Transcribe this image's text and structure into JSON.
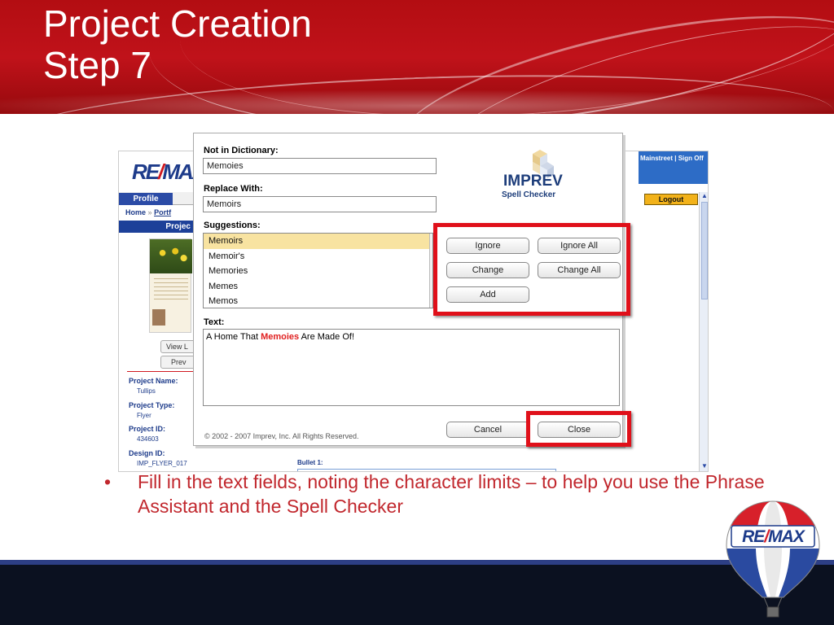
{
  "slide": {
    "title_line1": "Project Creation",
    "title_line2": "Step 7",
    "bullet": "Fill in the text fields, noting the character limits – to help you use the Phrase Assistant and the Spell Checker",
    "bullet_marker": "•"
  },
  "webpage": {
    "logo_text_left": "RE",
    "logo_text_slash": "/",
    "logo_text_right": "MAX",
    "profile_tab": "Profile",
    "nav_home": "Home",
    "nav_sep": "»",
    "nav_portfolio": "Portf",
    "project_bar": "Projec",
    "view_button": "View L",
    "preview_button": "Prev",
    "project_name_label": "Project Name:",
    "project_name_value": "Tullips",
    "project_type_label": "Project Type:",
    "project_type_value": "Flyer",
    "project_id_label": "Project ID:",
    "project_id_value": "434603",
    "design_id_label": "Design ID:",
    "design_id_value": "IMP_FLYER_017",
    "top_right_links": "Mainstreet | Sign Off",
    "logout_button": "Logout",
    "bullet_field_label": "Bullet 1:"
  },
  "spell_checker": {
    "not_in_dictionary_label": "Not in Dictionary:",
    "not_in_dictionary_value": "Memoies",
    "replace_with_label": "Replace With:",
    "replace_with_value": "Memoirs",
    "suggestions_label": "Suggestions:",
    "suggestions": [
      "Memoirs",
      "Memoir's",
      "Memories",
      "Memes",
      "Memos"
    ],
    "selected_suggestion": "Memoirs",
    "text_label": "Text:",
    "text_before": "A Home That ",
    "text_error_word": "Memoies",
    "text_after": " Are Made Of!",
    "buttons": {
      "ignore": "Ignore",
      "ignore_all": "Ignore All",
      "change": "Change",
      "change_all": "Change All",
      "add": "Add",
      "cancel": "Cancel",
      "close": "Close"
    },
    "copyright": "© 2002 - 2007 Imprev, Inc. All Rights Reserved.",
    "brand_name": "IMPREV",
    "brand_sub": "Spell Checker"
  },
  "balloon": {
    "logo_left": "RE",
    "logo_slash": "/",
    "logo_right": "MAX"
  },
  "colors": {
    "header_red": "#b30d12",
    "highlight_red": "#e0101a",
    "bullet_red": "#c1272d",
    "remax_blue": "#1d3b8a",
    "footer_navy": "#0b1120"
  }
}
